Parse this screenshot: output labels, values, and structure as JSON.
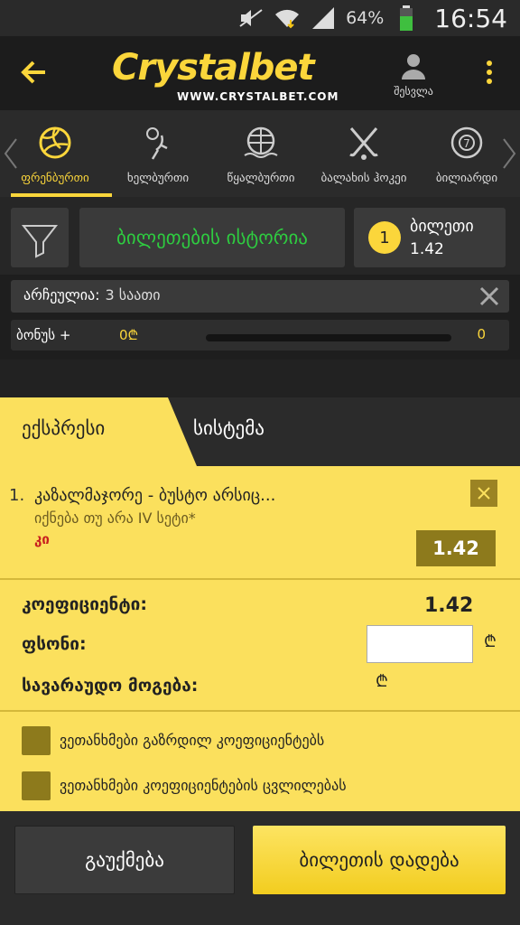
{
  "status_bar": {
    "battery": "64%",
    "time": "16:54"
  },
  "header": {
    "logo_brand": "Crystalbet",
    "logo_domain": "WWW.CRYSTALBET.COM",
    "profile_label": "შესვლა"
  },
  "sports": [
    {
      "label": "ფრენბურთი",
      "icon": "volleyball-icon",
      "active": true
    },
    {
      "label": "ხელბურთი",
      "icon": "handball-icon",
      "active": false
    },
    {
      "label": "წყალბურთი",
      "icon": "water-polo-icon",
      "active": false
    },
    {
      "label": "ბალახის ჰოკეი",
      "icon": "field-hockey-icon",
      "active": false
    },
    {
      "label": "ბილიარდი",
      "icon": "billiards-icon",
      "active": false
    }
  ],
  "toolbar": {
    "history_label": "ბილეთების ისტორია",
    "ticket_count": "1",
    "ticket_label": "ბილეთი",
    "ticket_odds": "1.42"
  },
  "selected": {
    "label": "არჩეულია:",
    "value": "3 საათი"
  },
  "bonus": {
    "label": "ბონუს +",
    "amount": "0₾",
    "value": "0",
    "progress": 0
  },
  "tabs": {
    "express": "ექსპრესი",
    "system": "სისტემა"
  },
  "bet": {
    "number": "1.",
    "match": "კაზალმაჯორე - ბუსტო არსიც...",
    "market": "იქნება თუ არა IV სეტი*",
    "pick": "კი",
    "odds": "1.42"
  },
  "calc": {
    "coef_label": "კოეფიციენტი:",
    "coef_value": "1.42",
    "stake_label": "ფსონი:",
    "stake_value": "",
    "win_label": "სავარაუდო მოგება:",
    "currency": "₾"
  },
  "agreements": [
    {
      "label": "ვეთანხმები გაზრდილ კოეფიციენტებს",
      "checked": false
    },
    {
      "label": "ვეთანხმები კოეფიციენტების ცვლილებას",
      "checked": false
    }
  ],
  "footer": {
    "cancel_label": "გაუქმება",
    "place_label": "ბილეთის დადება"
  },
  "colors": {
    "accent": "#fbd63b",
    "panel": "#fbe05d",
    "dark": "#2b2b2b",
    "green": "#2ecc40"
  }
}
